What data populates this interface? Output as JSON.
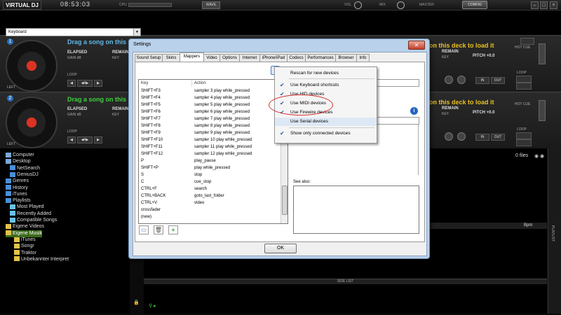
{
  "topbar": {
    "logo": "VIRTUAL DJ",
    "clock": "08:53:03",
    "cpu_label": "CPU",
    "wave_label": "WAVE",
    "vol_label": "VOL",
    "mix_label": "MIX",
    "master_label": "MASTER",
    "config_label": "CONFIG"
  },
  "deck1": {
    "number": "1",
    "drag_text": "Drag a song on this deck",
    "elapsed": "ELAPSED",
    "gain": "GAIN dB",
    "remain": "REMAIN",
    "key": "KEY",
    "loop": "LOOP",
    "side": "LEFT"
  },
  "deck2": {
    "number": "2",
    "drag_text": "Drag a song on this deck",
    "elapsed": "ELAPSED",
    "gain": "GAIN dB",
    "remain": "REMAIN",
    "key": "KEY",
    "loop": "LOOP",
    "side": "LEFT"
  },
  "right_deck1": {
    "drag_text": "on this deck to load it",
    "remain": "REMAIN",
    "key": "KEY",
    "pitch": "PITCH +0.0",
    "hot_cue": "HOT CUE",
    "in": "IN",
    "out": "OUT",
    "loop": "LOOP"
  },
  "right_deck2": {
    "drag_text": "on this deck to load it",
    "remain": "REMAIN",
    "key": "KEY",
    "pitch": "PITCH +0.0",
    "hot_cue": "HOT CUE",
    "in": "IN",
    "out": "OUT",
    "loop": "LOOP"
  },
  "tree": {
    "items": [
      {
        "label": "Computer",
        "indent": 0,
        "color": "#7aa9d8"
      },
      {
        "label": "Desktop",
        "indent": 0,
        "color": "#7aa9d8"
      },
      {
        "label": "NetSearch",
        "indent": 1,
        "color": "#4a8fd8"
      },
      {
        "label": "GeniusDJ",
        "indent": 1,
        "color": "#4a8fd8"
      },
      {
        "label": "Genres",
        "indent": 0,
        "color": "#4a8fd8"
      },
      {
        "label": "History",
        "indent": 0,
        "color": "#4a8fd8"
      },
      {
        "label": "iTunes",
        "indent": 0,
        "color": "#4a8fd8"
      },
      {
        "label": "Playlists",
        "indent": 0,
        "color": "#4a8fd8"
      },
      {
        "label": "Most Played",
        "indent": 1,
        "color": "#6bc2e6"
      },
      {
        "label": "Recently Added",
        "indent": 1,
        "color": "#6bc2e6"
      },
      {
        "label": "Compatible Songs",
        "indent": 1,
        "color": "#6bc2e6"
      },
      {
        "label": "Eigene Videos",
        "indent": 0,
        "color": "#e3c24a"
      },
      {
        "label": "Eigene Musik",
        "indent": 0,
        "color": "#e3c24a"
      },
      {
        "label": "iTunes",
        "indent": 2,
        "color": "#e3c24a"
      },
      {
        "label": "Songr",
        "indent": 2,
        "color": "#e3c24a"
      },
      {
        "label": "Traktor",
        "indent": 2,
        "color": "#e3c24a"
      },
      {
        "label": "Unbekannter Interpret",
        "indent": 2,
        "color": "#e3c24a"
      }
    ]
  },
  "browser": {
    "files_count": "0 files",
    "side_list": "SIDE LIST",
    "bpm_header": "Bpm",
    "playlist_tab": "PLAYLIST"
  },
  "settings": {
    "title": "Settings",
    "close": "✕",
    "tabs": [
      "Sound Setup",
      "Skins",
      "Mappers",
      "Video",
      "Options",
      "Internet",
      "iPhone/iPad",
      "Codecs",
      "Performances",
      "Browser",
      "Info"
    ],
    "active_tab": "Mappers",
    "mapper_select": "Keyboard",
    "columns": {
      "key": "Key",
      "action": "Action"
    },
    "rows": [
      {
        "key": "SHIFT+F3",
        "action": "sampler 3 play while_pressed"
      },
      {
        "key": "SHIFT+F4",
        "action": "sampler 4 play while_pressed"
      },
      {
        "key": "SHIFT+F5",
        "action": "sampler 5 play while_pressed"
      },
      {
        "key": "SHIFT+F6",
        "action": "sampler 6 play while_pressed"
      },
      {
        "key": "SHIFT+F7",
        "action": "sampler 7 play while_pressed"
      },
      {
        "key": "SHIFT+F8",
        "action": "sampler 8 play while_pressed"
      },
      {
        "key": "SHIFT+F9",
        "action": "sampler 9 play while_pressed"
      },
      {
        "key": "SHIFT+F10",
        "action": "sampler 10 play while_pressed"
      },
      {
        "key": "SHIFT+F11",
        "action": "sampler 11 play while_pressed"
      },
      {
        "key": "SHIFT+F12",
        "action": "sampler 12 play while_pressed"
      },
      {
        "key": "P",
        "action": "play_pause"
      },
      {
        "key": "SHIFT+P",
        "action": "play while_pressed"
      },
      {
        "key": "S",
        "action": "stop"
      },
      {
        "key": "C",
        "action": "cue_stop"
      },
      {
        "key": "CTRL+F",
        "action": "search"
      },
      {
        "key": "CTRL+BACK",
        "action": "goto_last_folder"
      },
      {
        "key": "CTRL+V",
        "action": "video"
      },
      {
        "key": "crossfader",
        "action": ""
      },
      {
        "key": "(new)",
        "action": ""
      }
    ],
    "see_also": "See also:",
    "ok": "OK"
  },
  "menu": {
    "items": [
      {
        "label": "Rescan for new devices",
        "checked": false
      },
      {
        "label": "Use Keyboard shortcuts",
        "checked": true
      },
      {
        "label": "Use HID devices",
        "checked": true
      },
      {
        "label": "Use MIDI devices",
        "checked": true
      },
      {
        "label": "Use Firewire devices",
        "checked": true
      },
      {
        "label": "Use Serial devices",
        "checked": false
      },
      {
        "label": "Show only connected devices",
        "checked": true
      }
    ]
  }
}
